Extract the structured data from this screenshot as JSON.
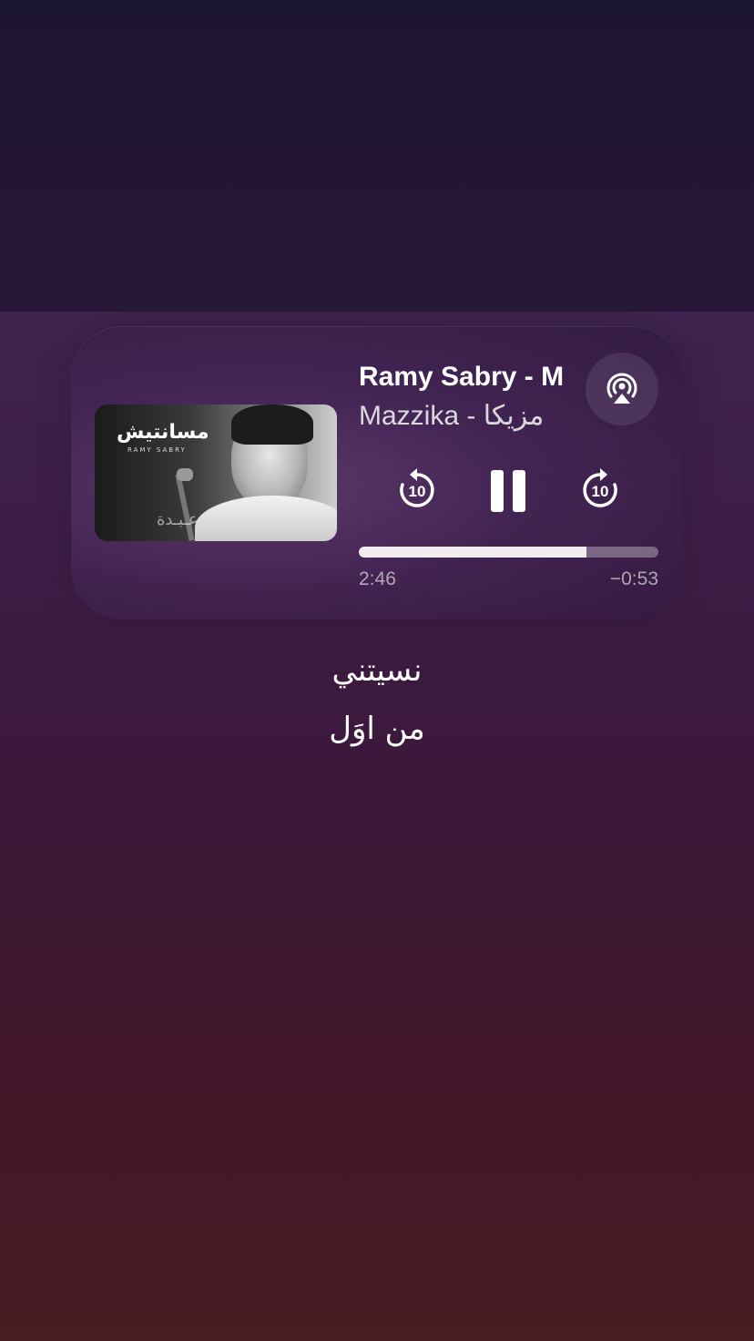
{
  "now_playing": {
    "title": "Ramy Sabry - M",
    "artist": "Mazzika - مزيكا",
    "elapsed": "2:46",
    "remaining": "−0:53",
    "progress": 0.76,
    "artwork": {
      "title_text": "مسانتيش",
      "subtitle_text": "RAMY SABRY",
      "watermark": "عـبـدة"
    }
  },
  "controls": {
    "skip_back_seconds": "10",
    "skip_forward_seconds": "10",
    "airplay_icon": "airplay-icon",
    "pause_icon": "pause-icon"
  },
  "lyrics": {
    "line1": "نسيتني",
    "line2": "من اوَل"
  },
  "colors": {
    "accent": "#ffffff",
    "track": "#6b5566"
  }
}
